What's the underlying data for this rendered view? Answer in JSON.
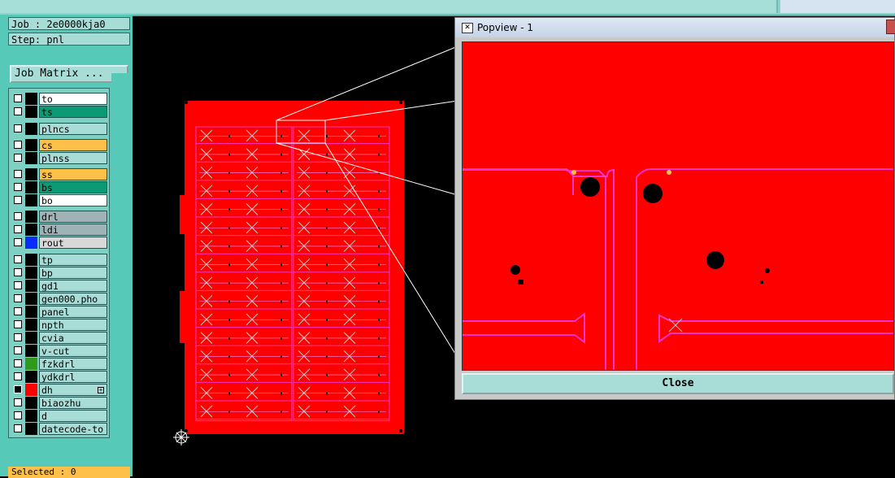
{
  "topbar": {},
  "info": {
    "job": "Job : 2e0000kja0",
    "step": "Step: pnl",
    "job_matrix_label": "Job Matrix ..."
  },
  "layers": [
    {
      "name": "to",
      "bg": "#ffffff",
      "swatch": "#000000"
    },
    {
      "name": "ts",
      "bg": "#0b9a74",
      "swatch": "#000000"
    },
    {
      "name": "plncs",
      "bg": "#a8dcd6",
      "swatch": "#000000"
    },
    {
      "name": "cs",
      "bg": "#ffc04a",
      "swatch": "#000000"
    },
    {
      "name": "plnss",
      "bg": "#a8dcd6",
      "swatch": "#000000"
    },
    {
      "name": "ss",
      "bg": "#ffc04a",
      "swatch": "#000000"
    },
    {
      "name": "bs",
      "bg": "#0b9a74",
      "swatch": "#000000"
    },
    {
      "name": "bo",
      "bg": "#ffffff",
      "swatch": "#000000"
    },
    {
      "name": "drl",
      "bg": "#9fb3b6",
      "swatch": "#000000"
    },
    {
      "name": "ldi",
      "bg": "#9fb3b6",
      "swatch": "#000000"
    },
    {
      "name": "rout",
      "bg": "#d8d8d8",
      "swatch": "#0a2bff"
    },
    {
      "name": "tp",
      "bg": "#a8dcd6",
      "swatch": "#000000"
    },
    {
      "name": "bp",
      "bg": "#a8dcd6",
      "swatch": "#000000"
    },
    {
      "name": "gd1",
      "bg": "#a8dcd6",
      "swatch": "#000000"
    },
    {
      "name": "gen000.pho",
      "bg": "#a8dcd6",
      "swatch": "#000000"
    },
    {
      "name": "panel",
      "bg": "#a8dcd6",
      "swatch": "#000000"
    },
    {
      "name": "npth",
      "bg": "#a8dcd6",
      "swatch": "#000000"
    },
    {
      "name": "cvia",
      "bg": "#a8dcd6",
      "swatch": "#000000"
    },
    {
      "name": "v-cut",
      "bg": "#a8dcd6",
      "swatch": "#000000"
    },
    {
      "name": "fzkdrl",
      "bg": "#a8dcd6",
      "swatch": "#2f9a1c"
    },
    {
      "name": "ydkdrl",
      "bg": "#a8dcd6",
      "swatch": "#000000"
    },
    {
      "name": "dh",
      "bg": "#a8dcd6",
      "swatch": "#ff0000",
      "active": true
    },
    {
      "name": "biaozhu",
      "bg": "#a8dcd6",
      "swatch": "#000000"
    },
    {
      "name": "d",
      "bg": "#a8dcd6",
      "swatch": "#000000"
    },
    {
      "name": "datecode-to",
      "bg": "#a8dcd6",
      "swatch": "#000000"
    }
  ],
  "selected_label": "Selected : 0",
  "popview": {
    "title": "Popview - 1",
    "close_label": "Close"
  },
  "colors": {
    "board": "#ff0000",
    "outline": "#ff33cc",
    "panel_bg": "#57c9b8"
  }
}
